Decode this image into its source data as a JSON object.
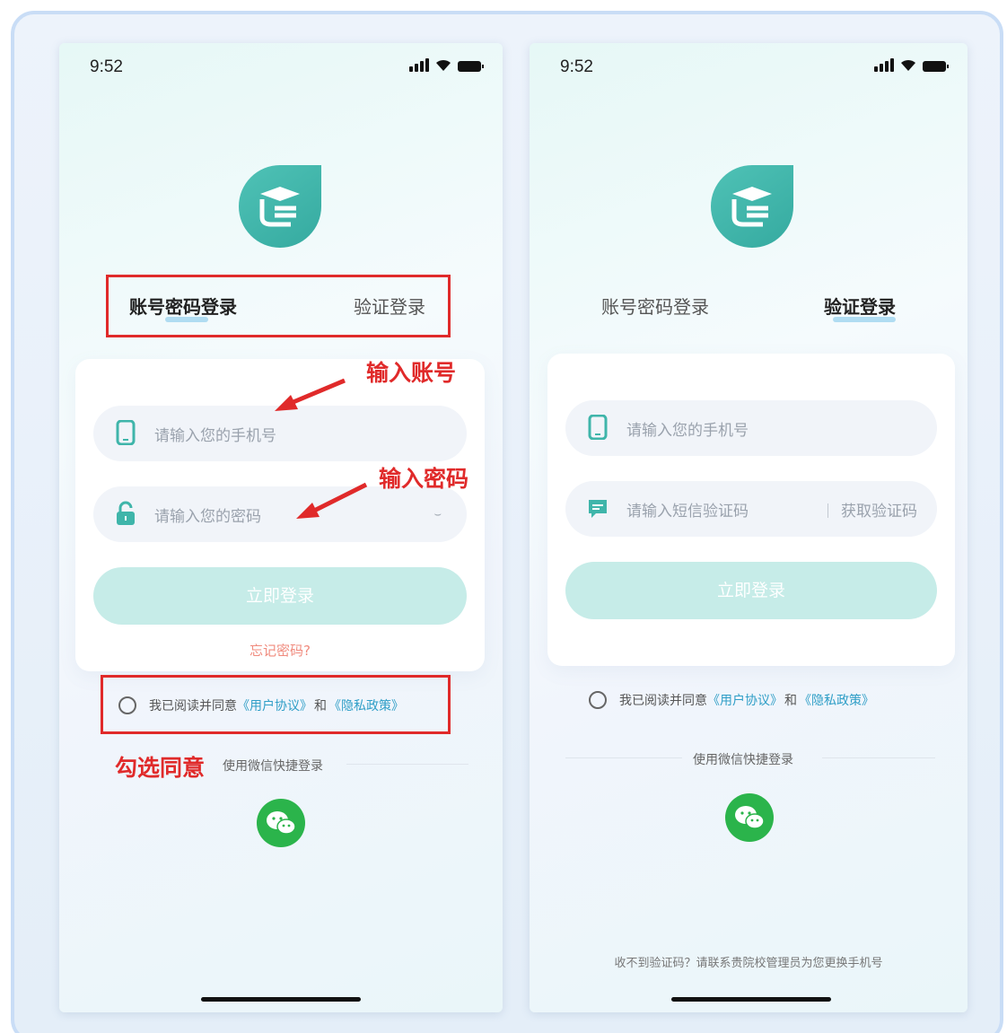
{
  "status": {
    "time": "9:52"
  },
  "tabs": {
    "password": "账号密码登录",
    "verify": "验证登录"
  },
  "fields": {
    "phone_placeholder": "请输入您的手机号",
    "password_placeholder": "请输入您的密码",
    "sms_placeholder": "请输入短信验证码",
    "get_code": "获取验证码"
  },
  "login_button": "立即登录",
  "forgot_password": "忘记密码?",
  "agreement": {
    "prefix": "我已阅读并同意",
    "user_agreement": "《用户协议》",
    "and": "和",
    "privacy_policy": "《隐私政策》"
  },
  "wechat_login": "使用微信快捷登录",
  "bottom_note": "收不到验证码？请联系贵院校管理员为您更换手机号",
  "annotations": {
    "enter_account": "输入账号",
    "enter_password": "输入密码",
    "check_agree": "勾选同意"
  },
  "colors": {
    "teal": "#3fb5aa",
    "annotation_red": "#e02a2a",
    "link_blue": "#2f9ec7",
    "wechat_green": "#2bb44b"
  },
  "icons": [
    "signal-icon",
    "wifi-icon",
    "battery-icon",
    "app-logo-icon",
    "phone-icon",
    "lock-icon",
    "eye-closed-icon",
    "message-icon",
    "wechat-icon"
  ]
}
